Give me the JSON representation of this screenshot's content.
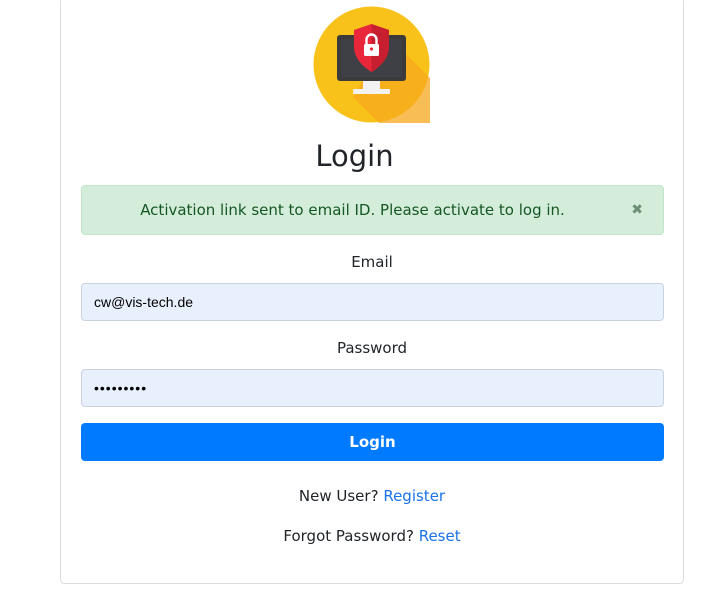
{
  "colors": {
    "primary": "#007bff",
    "alert_bg": "#d4edda",
    "alert_text": "#155724",
    "logo_circle": "#f9c21b",
    "logo_shield": "#e8283a"
  },
  "logo": {
    "icon": "monitor-lock-icon"
  },
  "title": "Login",
  "alert": {
    "message": "Activation link sent to email ID. Please activate to log in.",
    "close_glyph": "✖"
  },
  "email": {
    "label": "Email",
    "value": "cw@vis-tech.de"
  },
  "password": {
    "label": "Password",
    "value": "•••••••••"
  },
  "submit": {
    "label": "Login"
  },
  "register": {
    "prompt": "New User?",
    "link": "Register"
  },
  "reset": {
    "prompt": "Forgot Password?",
    "link": "Reset"
  }
}
